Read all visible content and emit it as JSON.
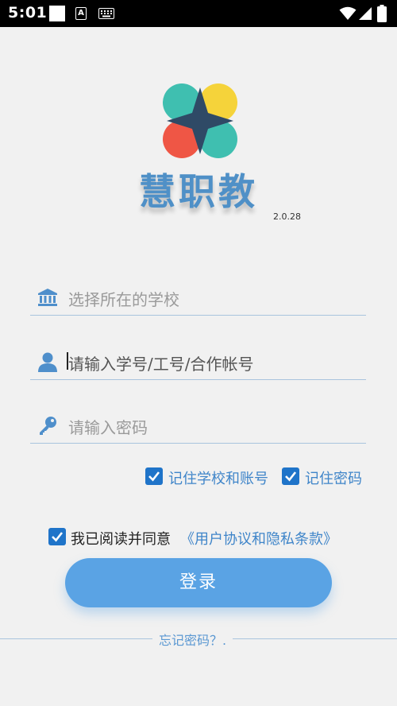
{
  "status_bar": {
    "time": "5:01",
    "icons": [
      "square-icon",
      "a-icon",
      "keyboard-icon",
      "wifi-icon",
      "signal-icon",
      "battery-icon"
    ]
  },
  "app": {
    "name": "慧职教",
    "version": "2.0.28"
  },
  "form": {
    "school": {
      "placeholder": "选择所在的学校",
      "icon": "bank-icon"
    },
    "account": {
      "placeholder": "请输入学号/工号/合作帐号",
      "icon": "user-icon"
    },
    "password": {
      "placeholder": "请输入密码",
      "icon": "key-icon"
    }
  },
  "options": {
    "remember_school_account": "记住学校和账号",
    "remember_password": "记住密码"
  },
  "agreement": {
    "prefix": "我已阅读并同意",
    "link": "《用户协议和隐私条款》"
  },
  "login_button": "登录",
  "forgot_password": "忘记密码？.",
  "colors": {
    "accent": "#5aa3e4",
    "checkbox": "#1f74c9",
    "link": "#3f85c9",
    "logo_yellow": "#f5d33a",
    "logo_red": "#ef5645",
    "logo_teal": "#3fbfb0",
    "logo_dark": "#2f4a66"
  }
}
